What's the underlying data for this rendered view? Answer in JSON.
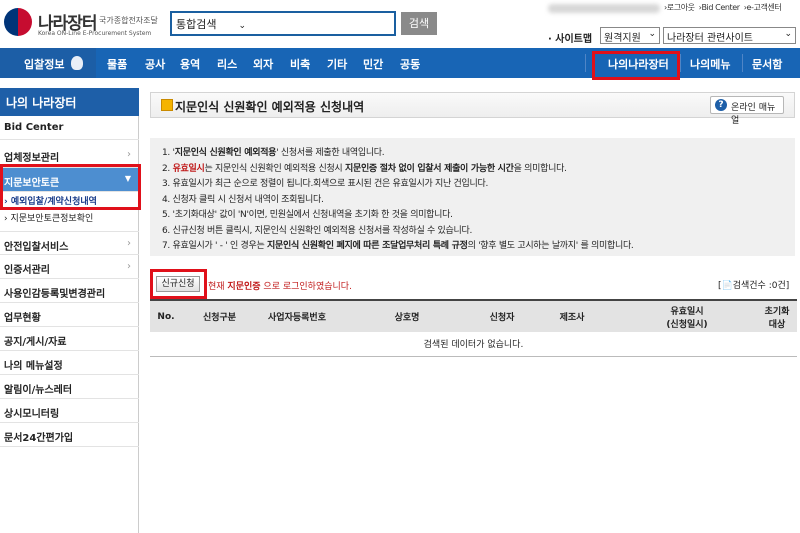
{
  "header": {
    "logo_title": "나라장터",
    "logo_subtitle": "국가종합전자조달",
    "logo_english": "Korea ON-Line E-Procurement System",
    "search_scope": "통합검색",
    "search_button": "검색",
    "top_links": [
      "›로그아웃",
      "›Bid Center",
      "›e-고객센터"
    ],
    "sitemap_label": "· 사이트맵",
    "remote_support": "원격지원",
    "related_sites": "나라장터 관련사이트"
  },
  "nav": {
    "home": "입찰정보",
    "items": [
      "물품",
      "공사",
      "용역",
      "리스",
      "외자",
      "비축",
      "기타",
      "민간",
      "공동"
    ],
    "right": [
      "나의나라장터",
      "나의메뉴",
      "문서함"
    ]
  },
  "sidebar": {
    "title": "나의 나라장터",
    "items": [
      {
        "label": "Bid Center",
        "arrow": ""
      },
      {
        "label": "업체정보관리",
        "arrow": "›"
      },
      {
        "label": "지문보안토큰",
        "arrow": "▼"
      },
      {
        "label": "안전입찰서비스",
        "arrow": "›"
      },
      {
        "label": "인증서관리",
        "arrow": "›"
      },
      {
        "label": "사용인감등록및변경관리",
        "arrow": ""
      },
      {
        "label": "업무현황",
        "arrow": ""
      },
      {
        "label": "공지/게시/자료",
        "arrow": ""
      },
      {
        "label": "나의 메뉴설정",
        "arrow": ""
      },
      {
        "label": "알림이/뉴스레터",
        "arrow": ""
      },
      {
        "label": "상시모니터링",
        "arrow": ""
      },
      {
        "label": "문서24간편가입",
        "arrow": ""
      }
    ],
    "subitems": [
      "› 예외입찰/계약신청내역",
      "› 지문보안토큰정보확인"
    ]
  },
  "page": {
    "title": "지문인식 신원확인 예외적용 신청내역",
    "manual_button": "온라인 매뉴얼",
    "notices": {
      "n1a": "1. '",
      "n1b": "지문인식 신원확인 예외적용",
      "n1c": "' 신청서를 제출한 내역입니다.",
      "n2a": "2. ",
      "n2b": "유효일시",
      "n2c": "는 지문인식 신원확인 예외적용 신청시 ",
      "n2d": "지문인증 절차 없이 입찰서 제출이 가능한 시간",
      "n2e": "을 의미합니다.",
      "n3": "3. 유효일시가 최근 순으로 정렬이 됩니다.회색으로 표시된 건은 유효일시가 지난 건입니다.",
      "n4": "4. 신청자 클릭 시 신청서 내역이 조회됩니다.",
      "n5": "5. '초기화대상' 값이 'N'이면, 민원실에서 신청내역을 초기화 한 것을 의미합니다.",
      "n6": "6. 신규신청 버튼 클릭시, 지문인식 신원확인 예외적용 신청서를 작성하실 수 있습니다.",
      "n7a": "7. 유효일시가 ' - ' 인 경우는 ",
      "n7b": "지문인식 신원확인 폐지에 따른 조달업무처리 특례 규정",
      "n7c": "의 '향후 별도 고시하는 날까지' 를 의미합니다."
    },
    "new_button": "신규신청",
    "login_msg_a": "현재 ",
    "login_msg_b": "지문인증",
    "login_msg_c": " 으로 로그인하였습니다.",
    "count": "[📄검색건수 :0건]",
    "columns": [
      "No.",
      "신청구분",
      "사업자등록번호",
      "상호명",
      "신청자",
      "제조사",
      "유효일시\n(신청일시)",
      "초기화\n대상"
    ],
    "empty_message": "검색된 데이터가 없습니다."
  }
}
